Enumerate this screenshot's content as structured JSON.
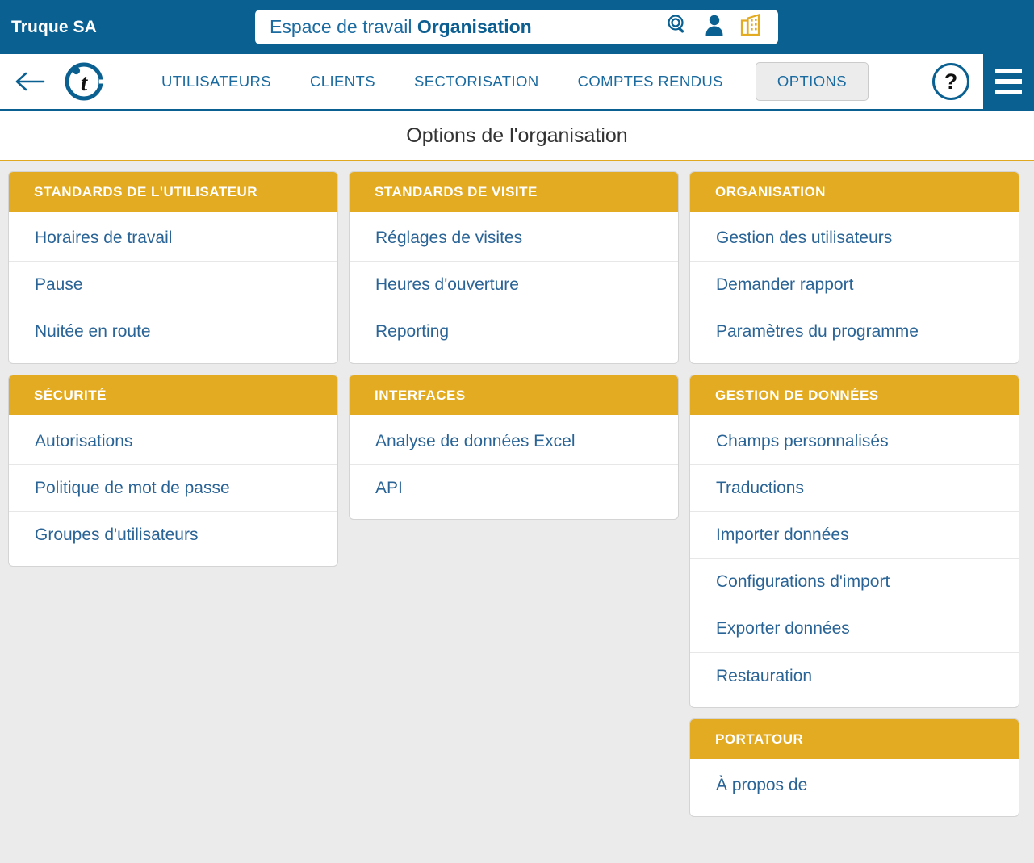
{
  "topbar": {
    "brand": "Truque SA",
    "workspace_prefix": "Espace de travail ",
    "workspace_name": "Organisation",
    "icons": [
      "search-icon",
      "user-icon",
      "building-icon"
    ]
  },
  "nav": {
    "back": "back-arrow-icon",
    "logo": "portatour-t-logo",
    "links": [
      {
        "label": "UTILISATEURS",
        "active": false
      },
      {
        "label": "CLIENTS",
        "active": false
      },
      {
        "label": "SECTORISATION",
        "active": false
      },
      {
        "label": "COMPTES RENDUS",
        "active": false
      },
      {
        "label": "OPTIONS",
        "active": true
      }
    ],
    "help_label": "?",
    "menu": "hamburger-menu-icon"
  },
  "page": {
    "title": "Options de l'organisation"
  },
  "colors": {
    "header_blue": "#0a6091",
    "accent_amber": "#e3ab21",
    "link_blue": "#2a6496",
    "page_bg": "#ebebeb"
  },
  "columns": [
    {
      "cards": [
        {
          "title": "STANDARDS DE L'UTILISATEUR",
          "items": [
            "Horaires de travail",
            "Pause",
            "Nuitée en route"
          ]
        },
        {
          "title": "SÉCURITÉ",
          "items": [
            "Autorisations",
            "Politique de mot de passe",
            "Groupes d'utilisateurs"
          ]
        }
      ]
    },
    {
      "cards": [
        {
          "title": "STANDARDS DE VISITE",
          "items": [
            "Réglages de visites",
            "Heures d'ouverture",
            "Reporting"
          ]
        },
        {
          "title": "INTERFACES",
          "items": [
            "Analyse de données Excel",
            "API"
          ]
        }
      ]
    },
    {
      "cards": [
        {
          "title": "ORGANISATION",
          "items": [
            "Gestion des utilisateurs",
            "Demander rapport",
            "Paramètres du programme"
          ]
        },
        {
          "title": "GESTION DE DONNÉES",
          "items": [
            "Champs personnalisés",
            "Traductions",
            "Importer données",
            "Configurations d'import",
            "Exporter données",
            "Restauration"
          ]
        },
        {
          "title": "PORTATOUR",
          "items": [
            "À propos de"
          ]
        }
      ]
    }
  ]
}
